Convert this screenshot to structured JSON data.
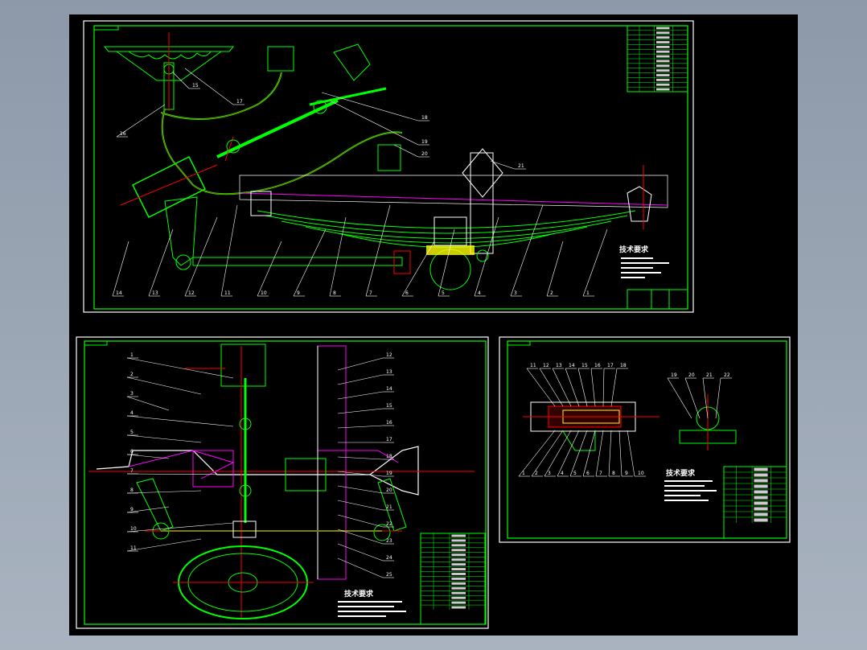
{
  "sheets": {
    "assembly": {
      "callouts_bottom": [
        "14",
        "13",
        "12",
        "11",
        "10",
        "9",
        "8",
        "7",
        "6",
        "5",
        "4",
        "3",
        "2",
        "1"
      ],
      "callouts_right": [
        "15",
        "16",
        "17",
        "18",
        "19",
        "20",
        "21"
      ],
      "notes_heading": "技术要求"
    },
    "plan": {
      "callouts_left": [
        "1",
        "2",
        "3",
        "4",
        "5",
        "6",
        "7",
        "8",
        "9",
        "10",
        "11"
      ],
      "callouts_right": [
        "12",
        "13",
        "14",
        "15",
        "16",
        "17",
        "18",
        "19",
        "20",
        "21",
        "22",
        "23",
        "24",
        "25"
      ],
      "notes_heading": "技术要求"
    },
    "detail": {
      "callouts_top": [
        "11",
        "12",
        "13",
        "14",
        "15",
        "16",
        "17",
        "18"
      ],
      "callouts_bottom": [
        "1",
        "2",
        "3",
        "4",
        "5",
        "6",
        "7",
        "8",
        "9",
        "10"
      ],
      "callouts_side": [
        "19",
        "20",
        "21",
        "22"
      ],
      "notes_heading": "技术要求"
    }
  },
  "colors": {
    "background": "#000000",
    "border": "#ffffff",
    "frame": "#00ff00",
    "centerline": "#ff0000",
    "dim": "#ff00ff",
    "hatch": "#ffff00"
  }
}
